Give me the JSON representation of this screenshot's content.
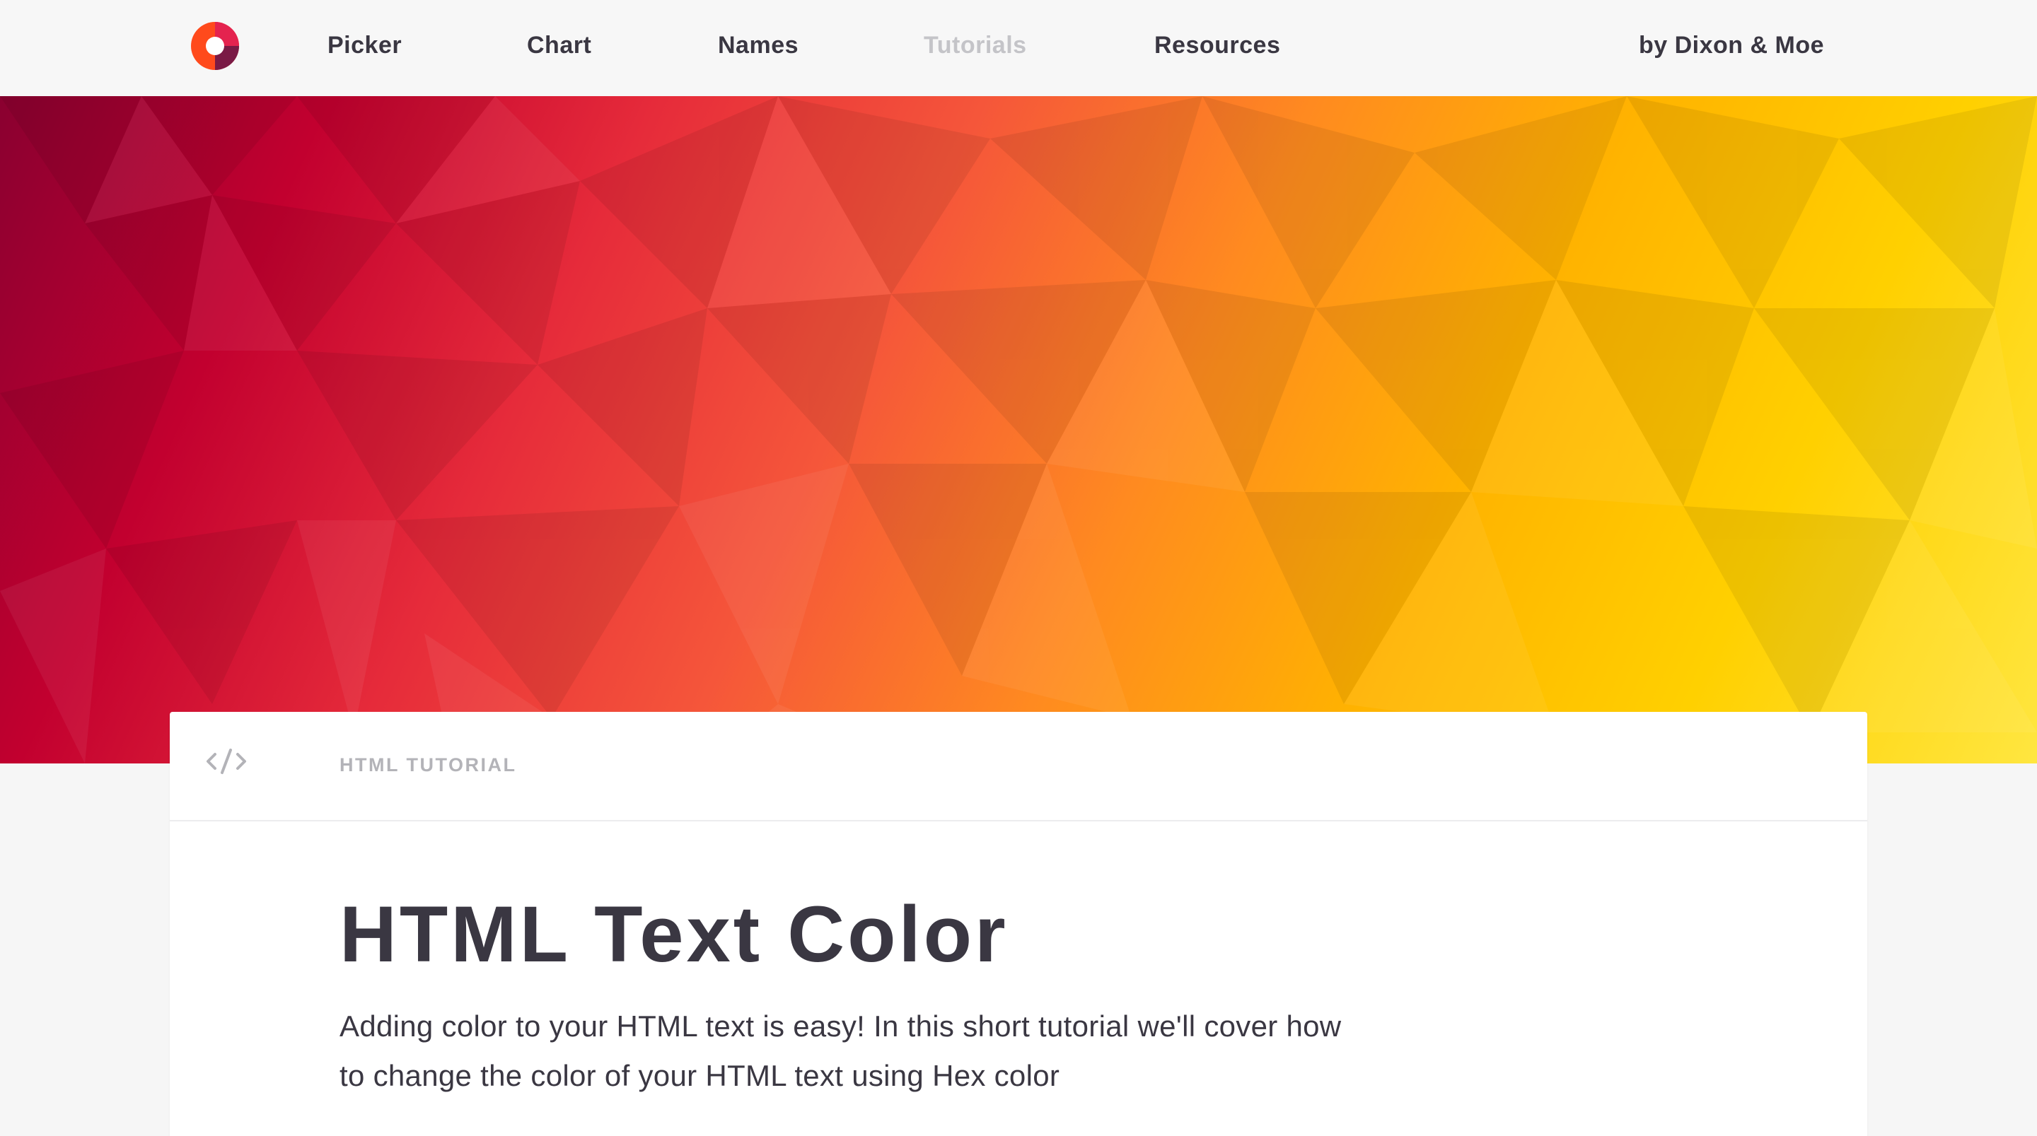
{
  "nav": {
    "picker": "Picker",
    "chart": "Chart",
    "names": "Names",
    "tutorials": "Tutorials",
    "resources": "Resources",
    "credit": "by Dixon & Moe"
  },
  "logo": {
    "icon": "logo-ring-icon",
    "colors": [
      "#ff4a1c",
      "#e4234f",
      "#7a1a45"
    ]
  },
  "hero": {
    "gradient_colors": [
      "#8a0030",
      "#c2002f",
      "#f5563a",
      "#ff8a20",
      "#ffd000",
      "#ffe640"
    ]
  },
  "card": {
    "icon": "code-icon",
    "label": "HTML TUTORIAL",
    "title": "HTML Text Color",
    "intro": "Adding color to your HTML text is easy! In this short tutorial we'll cover how to change the color of your HTML text using Hex color"
  }
}
